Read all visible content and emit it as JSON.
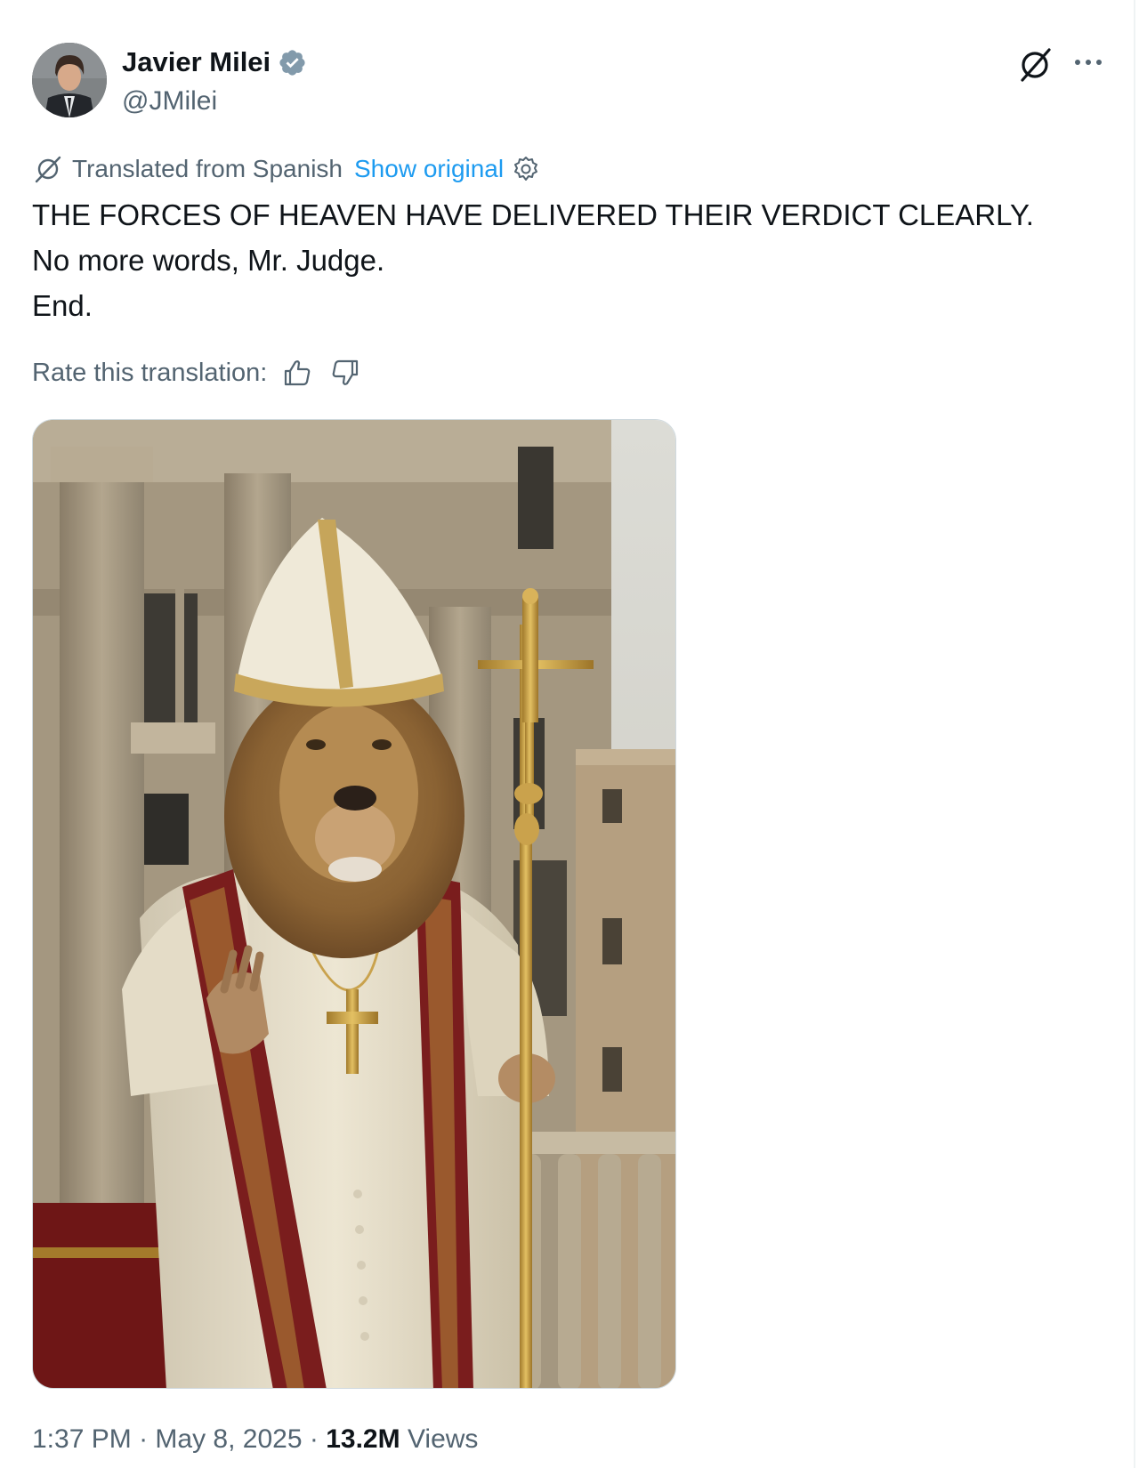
{
  "author": {
    "display_name": "Javier Milei",
    "handle": "@JMilei",
    "verified": true
  },
  "translation": {
    "label": "Translated from Spanish",
    "show_original": "Show original"
  },
  "tweet": {
    "lines": [
      "THE FORCES OF HEAVEN HAVE DELIVERED THEIR VERDICT CLEARLY.",
      "No more words, Mr. Judge.",
      "End."
    ]
  },
  "rating": {
    "label": "Rate this translation:"
  },
  "meta": {
    "time": "1:37 PM",
    "separator": "·",
    "date": "May 8, 2025",
    "views_count": "13.2M",
    "views_label": "Views"
  },
  "icons": {
    "verified": "verified-badge-icon",
    "grok": "grok-icon",
    "more": "more-icon",
    "translate": "translate-icon",
    "settings": "gear-icon",
    "thumbs_up": "thumbs-up-icon",
    "thumbs_down": "thumbs-down-icon"
  },
  "colors": {
    "text": "#0f1419",
    "secondary": "#536471",
    "link": "#1d9bf0",
    "verified": "#829aab"
  }
}
